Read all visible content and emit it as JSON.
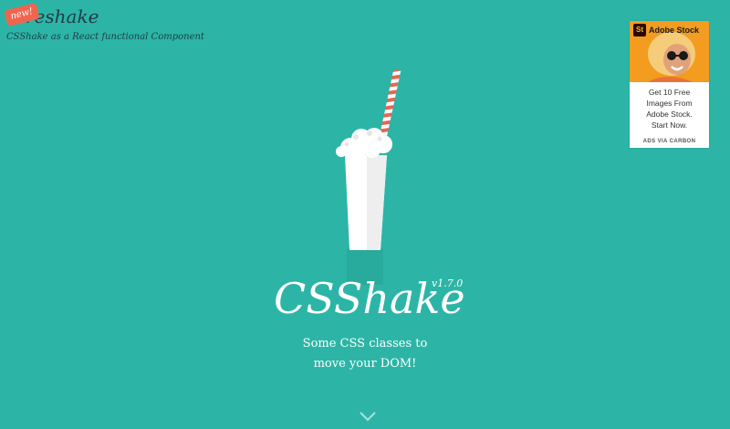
{
  "react_promo": {
    "badge": "new!",
    "name": "reshake",
    "subtitle": "CSShake as a React functional Component"
  },
  "ad": {
    "brand": "Adobe Stock",
    "logo_text": "St",
    "text_lines": [
      "Get 10 Free",
      "Images From",
      "Adobe Stock.",
      "Start Now."
    ],
    "via": "ADS VIA CARBON",
    "accent": "#f39c1f"
  },
  "hero": {
    "title": "CSShake",
    "version": "v1.7.0",
    "tagline_lines": [
      "Some CSS classes to",
      "move your DOM!"
    ]
  },
  "icons": {
    "milkshake": "milkshake-illustration",
    "scroll": "chevron-down-icon"
  },
  "colors": {
    "background": "#2cb5a6",
    "straw_stripe": "#e8664f",
    "text": "#ffffff",
    "react_text": "#1f3b45"
  }
}
